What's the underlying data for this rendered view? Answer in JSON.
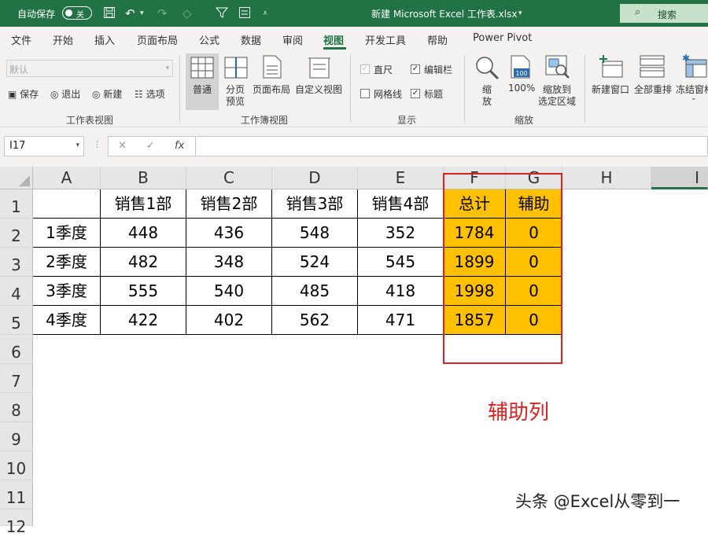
{
  "titlebar": {
    "autosave_label": "自动保存",
    "autosave_state": "关",
    "doc_title": "新建 Microsoft Excel 工作表.xlsx",
    "search_label": "搜索"
  },
  "tabs": [
    "文件",
    "开始",
    "插入",
    "页面布局",
    "公式",
    "数据",
    "审阅",
    "视图",
    "开发工具",
    "帮助",
    "Power Pivot"
  ],
  "active_tab": "视图",
  "ribbon": {
    "sheet_view": {
      "dropdown_value": "默认",
      "keep": "保存",
      "exit": "退出",
      "new": "新建",
      "options": "选项",
      "label": "工作表视图"
    },
    "workbook_views": {
      "normal": "普通",
      "page_break_l1": "分页",
      "page_break_l2": "预览",
      "page_layout": "页面布局",
      "custom_views": "自定义视图",
      "label": "工作簿视图"
    },
    "show": {
      "ruler": "直尺",
      "formula_bar": "编辑栏",
      "gridlines": "网格线",
      "headings": "标题",
      "label": "显示"
    },
    "zoom": {
      "zoom_l1": "缩",
      "zoom_l2": "放",
      "hundred": "100%",
      "hundred_icon": "100",
      "zoom_sel_l1": "缩放到",
      "zoom_sel_l2": "选定区域",
      "label": "缩放"
    },
    "window": {
      "new_window": "新建窗口",
      "arrange_all": "全部重排",
      "freeze": "冻结窗格"
    }
  },
  "formula_bar": {
    "name_box": "I17",
    "fx": "fx",
    "formula": ""
  },
  "columns": [
    "A",
    "B",
    "C",
    "D",
    "E",
    "F",
    "G",
    "H",
    "I"
  ],
  "rows": [
    "1",
    "2",
    "3",
    "4",
    "5",
    "6",
    "7",
    "8",
    "9",
    "10",
    "11",
    "12"
  ],
  "table": {
    "header": [
      "",
      "销售1部",
      "销售2部",
      "销售3部",
      "销售4部",
      "总计",
      "辅助"
    ],
    "rows": [
      [
        "1季度",
        "448",
        "436",
        "548",
        "352",
        "1784",
        "0"
      ],
      [
        "2季度",
        "482",
        "348",
        "524",
        "545",
        "1899",
        "0"
      ],
      [
        "3季度",
        "555",
        "540",
        "485",
        "418",
        "1998",
        "0"
      ],
      [
        "4季度",
        "422",
        "402",
        "562",
        "471",
        "1857",
        "0"
      ]
    ]
  },
  "annotation": "辅助列",
  "watermark": "头条 @Excel从零到一",
  "colors": {
    "brand": "#217346",
    "highlight": "#ffc000",
    "annotation": "#e02020"
  }
}
